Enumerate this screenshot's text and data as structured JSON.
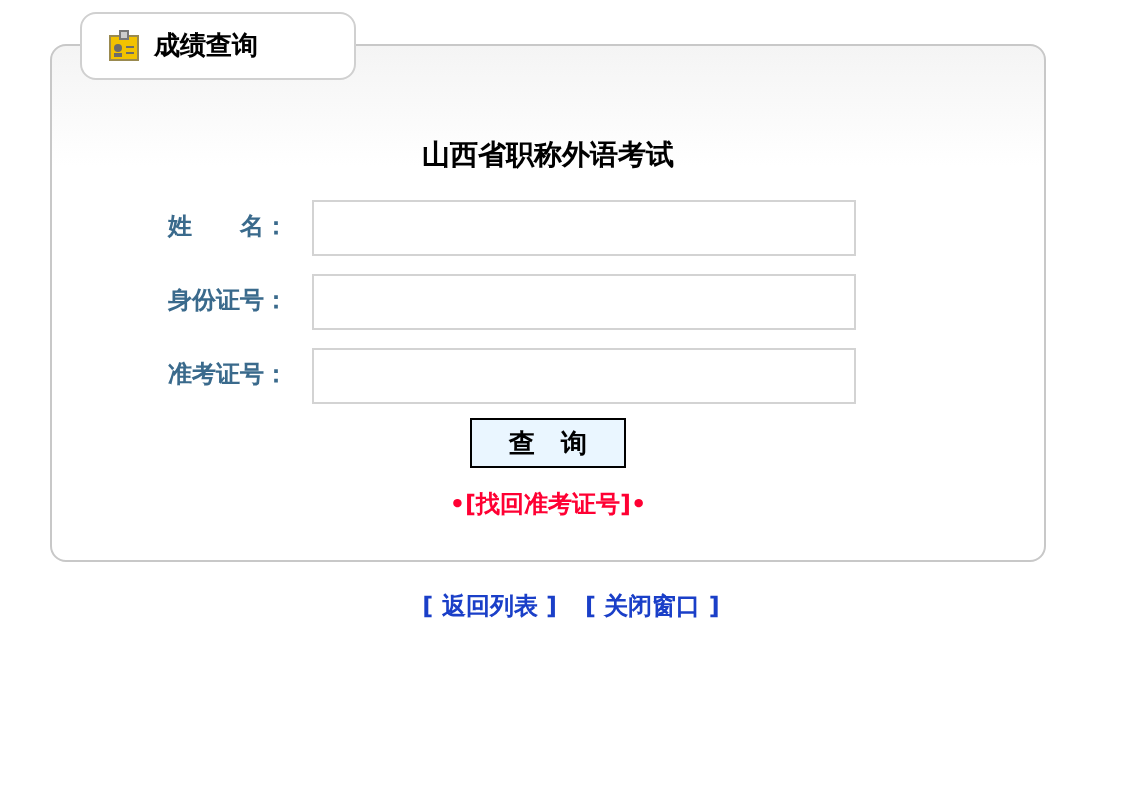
{
  "tab": {
    "label": "成绩查询"
  },
  "form": {
    "title": "山西省职称外语考试",
    "fields": [
      {
        "label": "姓　　名："
      },
      {
        "label": "身份证号："
      },
      {
        "label": "准考证号："
      }
    ],
    "submit": "查　询",
    "recover_link": "•[找回准考证号]•"
  },
  "footer_links": [
    "[ 返回列表 ]",
    "[ 关闭窗口 ]"
  ]
}
